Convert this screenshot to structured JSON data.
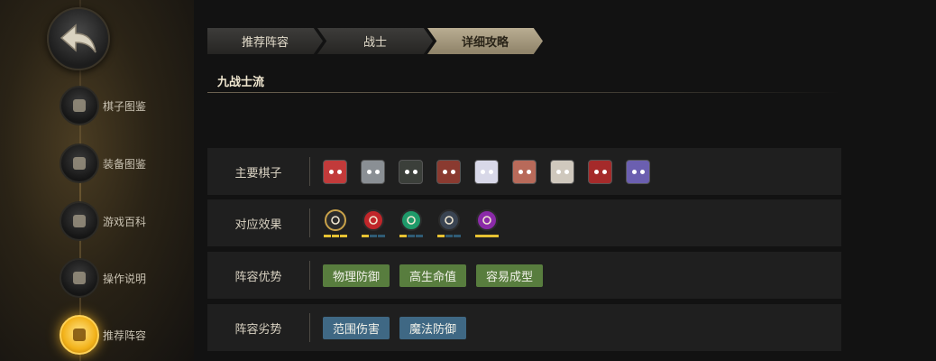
{
  "sidebar": {
    "back_icon": "back-arrow-icon",
    "items": [
      {
        "label": "棋子图鉴",
        "icon": "knight-chess-icon",
        "active": false
      },
      {
        "label": "装备图鉴",
        "icon": "armor-icon",
        "active": false
      },
      {
        "label": "游戏百科",
        "icon": "book-icon",
        "active": false
      },
      {
        "label": "操作说明",
        "icon": "pointer-hand-icon",
        "active": false
      },
      {
        "label": "推荐阵容",
        "icon": "chessboard-icon",
        "active": true
      }
    ]
  },
  "breadcrumb": [
    "推荐阵容",
    "战士",
    "详细攻略"
  ],
  "section_title": "九战士流",
  "rows": {
    "main_pieces_label": "主要棋子",
    "effects_label": "对应效果",
    "advantages_label": "阵容优势",
    "disadvantages_label": "阵容劣势"
  },
  "main_pieces": [
    {
      "name": "piece-1",
      "color": "#c23a3a"
    },
    {
      "name": "piece-2",
      "color": "#8a8f94"
    },
    {
      "name": "piece-3",
      "color": "#3b3f3a"
    },
    {
      "name": "piece-4",
      "color": "#8a3a30"
    },
    {
      "name": "piece-5",
      "color": "#d8d8e8"
    },
    {
      "name": "piece-6",
      "color": "#b86a5a"
    },
    {
      "name": "piece-7",
      "color": "#cfc8bd"
    },
    {
      "name": "piece-8",
      "color": "#a52a2a"
    },
    {
      "name": "piece-9",
      "color": "#6b5fb0"
    }
  ],
  "effects": [
    {
      "icon": "warrior-axe-icon",
      "color": "#2b2b2b",
      "ring": "#c9a24a",
      "pips": [
        1,
        1,
        1
      ]
    },
    {
      "icon": "red-arc-icon",
      "color": "#c0262a",
      "ring": "#2b2b2b",
      "pips": [
        1,
        0,
        0
      ]
    },
    {
      "icon": "paw-icon",
      "color": "#1f9a6a",
      "ring": "#2b2b2b",
      "pips": [
        1,
        0,
        0
      ]
    },
    {
      "icon": "knight-helm-icon",
      "color": "#3a4452",
      "ring": "#2b2b2b",
      "pips": [
        1,
        0,
        0
      ]
    },
    {
      "icon": "demon-skull-icon",
      "color": "#8a2aa8",
      "ring": "#2b2b2b",
      "pips": [
        1
      ]
    }
  ],
  "advantages": [
    "物理防御",
    "高生命值",
    "容易成型"
  ],
  "disadvantages": [
    "范围伤害",
    "魔法防御"
  ]
}
